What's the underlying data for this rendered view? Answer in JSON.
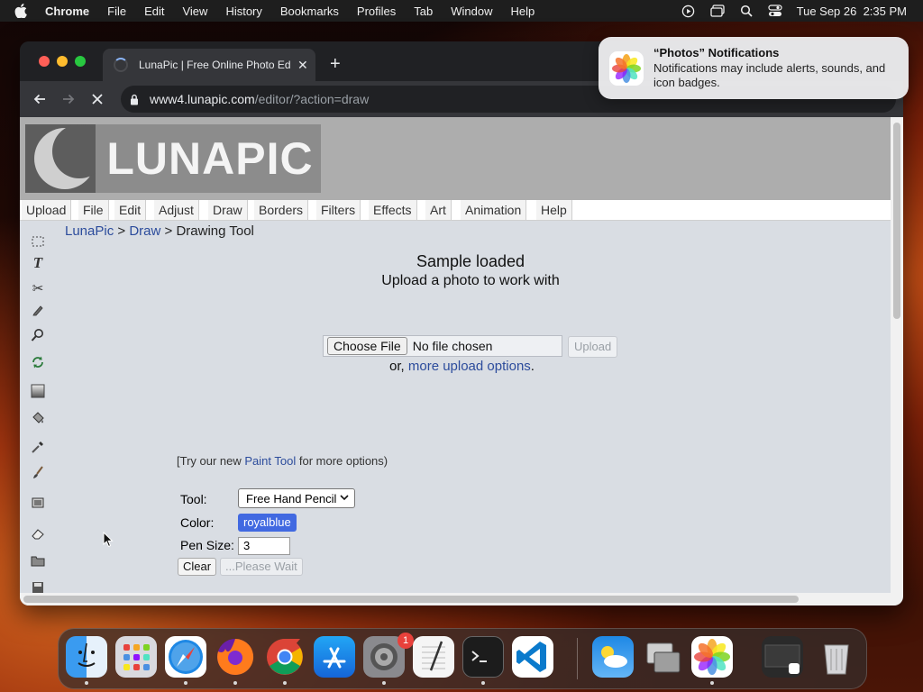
{
  "menubar": {
    "app_name": "Chrome",
    "items": [
      "File",
      "Edit",
      "View",
      "History",
      "Bookmarks",
      "Profiles",
      "Tab",
      "Window",
      "Help"
    ],
    "datetime": "Tue Sep 26  2:35 PM",
    "status_icons": [
      "play-circle-icon",
      "screen-mirror-icon",
      "search-icon",
      "control-center-icon"
    ]
  },
  "browser": {
    "tab_title": "LunaPic | Free Online Photo Editor",
    "url_host": "www4.lunapic.com",
    "url_path": "/editor/?action=draw"
  },
  "site": {
    "logo_text": "LUNAPIC",
    "menu": [
      "Upload",
      "File",
      "Edit",
      "Adjust",
      "Draw",
      "Borders",
      "Filters",
      "Effects",
      "Art",
      "Animation",
      "Help"
    ],
    "breadcrumb": {
      "home": "LunaPic",
      "sep1": " > ",
      "section": "Draw",
      "sep2": " > ",
      "current": "Drawing Tool"
    },
    "toolbox": [
      "selection-icon",
      "text-icon",
      "scissors-icon",
      "pencil-icon",
      "magnifier-icon",
      "rotate-icon",
      "gradient-icon",
      "paint-bucket-icon",
      "eyedropper-icon",
      "brush-icon",
      "crop-icon",
      "eraser-icon",
      "folder-icon",
      "save-icon"
    ]
  },
  "upload": {
    "heading": "Sample loaded",
    "subheading": "Upload a photo to work with",
    "choose_label": "Choose File",
    "file_status": "No file chosen",
    "upload_label": "Upload",
    "more_prefix": "or, ",
    "more_link": "more upload options",
    "more_suffix": "."
  },
  "paint_note": {
    "prefix": "[Try our new ",
    "link": "Paint Tool",
    "suffix": " for more options)"
  },
  "drawing": {
    "tool_label": "Tool:",
    "tool_value": "Free Hand Pencil",
    "color_label": "Color:",
    "color_value": "royalblue",
    "pen_label": "Pen Size:",
    "pen_value": "3",
    "clear_label": "Clear",
    "wait_label": "...Please Wait"
  },
  "notification": {
    "title": "“Photos” Notifications",
    "body": "Notifications may include alerts, sounds, and icon badges."
  },
  "dock": {
    "apps": [
      "finder-icon",
      "launchpad-icon",
      "safari-icon",
      "firefox-icon",
      "chrome-icon",
      "app-store-icon",
      "system-settings-icon",
      "textedit-icon",
      "terminal-icon",
      "vscode-icon",
      "weather-icon",
      "migration-assistant-icon",
      "photos-icon",
      "downloads-stack-icon",
      "trash-icon"
    ],
    "settings_badge": "1"
  },
  "colors": {
    "link": "#2c4c9c",
    "royalblue": "#4169e1",
    "page_bg": "#d9dde3"
  }
}
